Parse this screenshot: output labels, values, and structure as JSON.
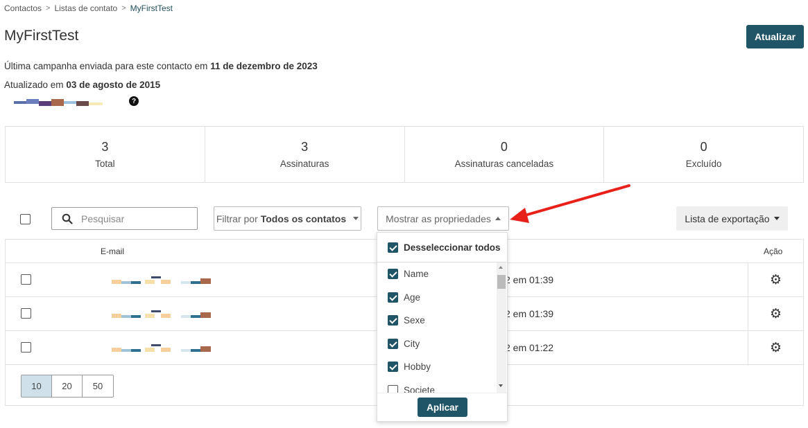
{
  "breadcrumb": {
    "items": [
      "Contactos",
      "Listas de contato"
    ],
    "current": "MyFirstTest"
  },
  "page": {
    "title": "MyFirstTest",
    "update_label": "Atualizar"
  },
  "meta": {
    "last_campaign_prefix": "Última campanha enviada para este contacto em",
    "last_campaign_date": "11 de dezembro de 2023",
    "updated_prefix": "Atualizado em",
    "updated_date": "03 de agosto de 2015"
  },
  "stats": [
    {
      "value": "3",
      "label": "Total"
    },
    {
      "value": "3",
      "label": "Assinaturas"
    },
    {
      "value": "0",
      "label": "Assinaturas canceladas"
    },
    {
      "value": "0",
      "label": "Excluído"
    }
  ],
  "toolbar": {
    "search_placeholder": "Pesquisar",
    "filter_prefix": "Filtrar por",
    "filter_value": "Todos os contatos",
    "properties_label": "Mostrar as propriedades",
    "export_label": "Lista de exportação"
  },
  "table": {
    "headers": {
      "email": "E-mail",
      "action": "Ação"
    },
    "rows": [
      {
        "date": "2 em 01:39"
      },
      {
        "date": "2 em 01:39"
      },
      {
        "date": "2 em 01:22"
      }
    ]
  },
  "pagination": {
    "options": [
      "10",
      "20",
      "50"
    ],
    "selected": "10"
  },
  "dropdown": {
    "deselect_all": "Desseleccionar todos",
    "items": [
      {
        "label": "Name",
        "checked": true
      },
      {
        "label": "Age",
        "checked": true
      },
      {
        "label": "Sexe",
        "checked": true
      },
      {
        "label": "City",
        "checked": true
      },
      {
        "label": "Hobby",
        "checked": true
      },
      {
        "label": "Societe",
        "checked": false
      }
    ],
    "apply_label": "Aplicar"
  },
  "colors": {
    "primary": "#1f5566",
    "annotation_arrow": "#e8201a",
    "pager_active": "#cfe0ea"
  },
  "icons": [
    "search-icon",
    "gear-icon",
    "help-icon",
    "chevron-right-icon",
    "caret-down-icon",
    "caret-up-icon"
  ]
}
